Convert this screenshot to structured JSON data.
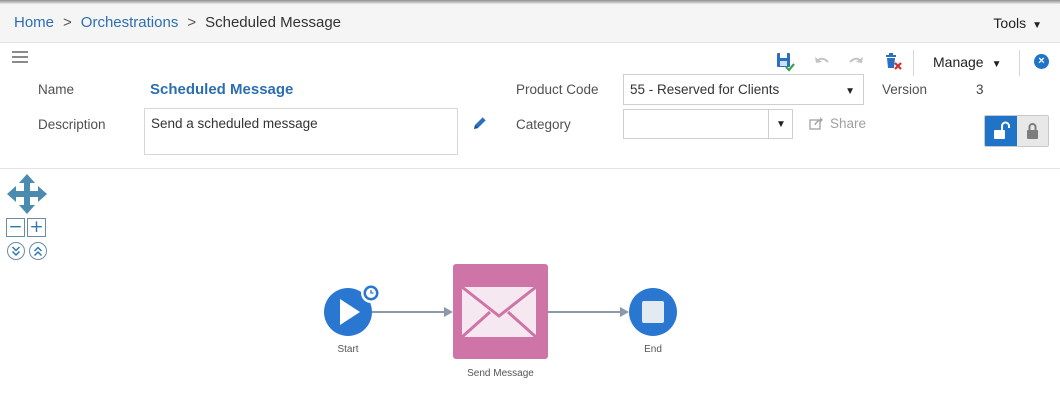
{
  "breadcrumb": {
    "items": [
      "Home",
      "Orchestrations"
    ],
    "separator": ">",
    "current": "Scheduled Message"
  },
  "tools_label": "Tools",
  "toolbar": {
    "manage_label": "Manage",
    "icons": [
      "save-icon",
      "undo-icon",
      "redo-icon",
      "delete-icon",
      "close-icon"
    ]
  },
  "form": {
    "name_label": "Name",
    "name_value": "Scheduled Message",
    "description_label": "Description",
    "description_value": "Send a scheduled message",
    "product_code_label": "Product Code",
    "product_code_value": "55 - Reserved for Clients",
    "version_label": "Version",
    "version_value": "3",
    "category_label": "Category",
    "category_value": "",
    "share_label": "Share"
  },
  "canvas": {
    "nodes": [
      {
        "label": "Start",
        "type": "start",
        "icon": "play-icon",
        "badge": "clock-icon"
      },
      {
        "label": "Send Message",
        "type": "task",
        "icon": "envelope-icon"
      },
      {
        "label": "End",
        "type": "end",
        "icon": "stop-icon"
      }
    ],
    "colors": {
      "event_blue": "#2a77d2",
      "task_pink": "#cf74a6",
      "connector": "#8a9aa8",
      "accent": "#1f74c8"
    }
  }
}
